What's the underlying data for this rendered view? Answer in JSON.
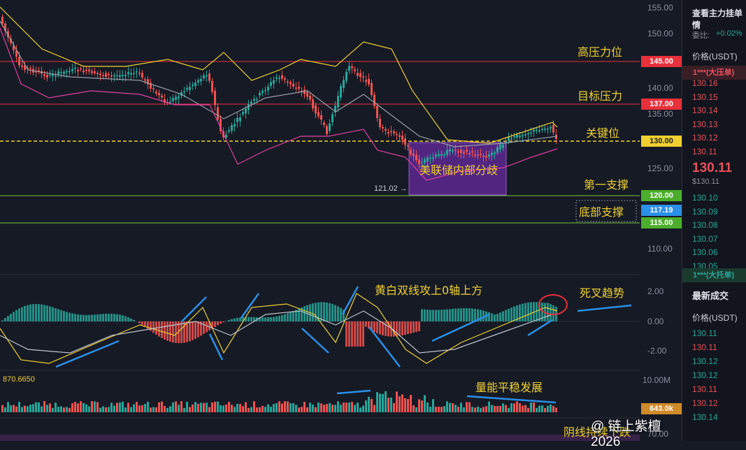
{
  "colors": {
    "bg": "#161a25",
    "yellow": "#f0d030",
    "red": "#e8303a",
    "green": "#76c442",
    "purple": "#7b2fbe",
    "up": "#26a69a",
    "down": "#ef5350",
    "blue": "#2a90e8"
  },
  "annotations": {
    "high_pressure": "高压力位",
    "target_pressure": "目标压力",
    "key_level": "关键位",
    "fed_divergence": "美联储内部分歧",
    "first_support": "第一支撑",
    "bottom_support": "底部支撑",
    "macd_note": "黄白双线攻上0轴上方",
    "death_cross": "死叉趋势",
    "volume_note": "量能平稳发展",
    "bearish_note": "阴线持续下跌",
    "low_marker": "121.02 →",
    "macd_value": "870.6650",
    "watermark": "链上紫檀 2026"
  },
  "price_axis": [
    "155.00",
    "150.00",
    "145.00",
    "140.00",
    "135.00",
    "130.00",
    "125.00",
    "120.00",
    "115.00",
    "110.00"
  ],
  "price_labels": {
    "l145": "145.00",
    "l137": "137.00",
    "l130": "130.00",
    "l120": "120.00",
    "l117": "117.19",
    "l115": "115.00"
  },
  "macd_axis": [
    "2.00",
    "0.00",
    "-2.00"
  ],
  "volume_axis": {
    "max": "10.00M",
    "current": "643.0k"
  },
  "rsi_axis": "70.00",
  "sidebar": {
    "title": "查看主力挂单情",
    "ratio_label": "委比:",
    "ratio_value": "+0.02%",
    "price_header": "价格(USDT)",
    "ask_wall": "1***(大压单)",
    "asks": [
      "130.16",
      "130.15",
      "130.14",
      "130.13",
      "130.12",
      "130.11"
    ],
    "last_price": "130.11",
    "last_usd": "$130.11",
    "bids": [
      "130.10",
      "130.09",
      "130.08",
      "130.07",
      "130.06",
      "130.05"
    ],
    "bid_wall": "1***(大托单)",
    "trades_tab": "最新成交",
    "trades_header": "价格(USDT)",
    "trades": [
      {
        "p": "130.11",
        "c": "green"
      },
      {
        "p": "130.11",
        "c": "red"
      },
      {
        "p": "130.12",
        "c": "green"
      },
      {
        "p": "130.12",
        "c": "green"
      },
      {
        "p": "130.11",
        "c": "red"
      },
      {
        "p": "130.12",
        "c": "red"
      },
      {
        "p": "130.14",
        "c": "green"
      }
    ]
  }
}
